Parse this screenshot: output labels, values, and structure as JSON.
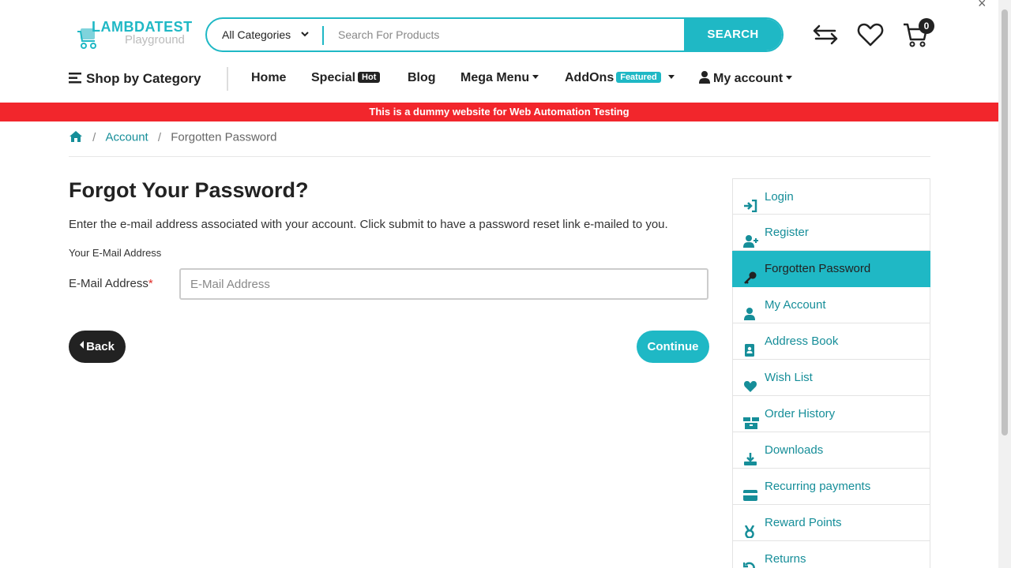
{
  "header": {
    "logo_brand": "LAMBDATEST",
    "logo_sub": "Playground",
    "category_select": "All Categories",
    "search_placeholder": "Search For Products",
    "search_button": "SEARCH",
    "cart_count": "0",
    "close_glyph": "×"
  },
  "nav": {
    "shop_by_category": "Shop by Category",
    "home": "Home",
    "special": "Special",
    "special_badge": "Hot",
    "blog": "Blog",
    "mega_menu": "Mega Menu",
    "addons": "AddOns",
    "addons_badge": "Featured",
    "my_account": "My account"
  },
  "banner": "This is a dummy website for Web Automation Testing",
  "breadcrumb": {
    "sep": "/",
    "account": "Account",
    "current": "Forgotten Password"
  },
  "main": {
    "title": "Forgot Your Password?",
    "intro": "Enter the e-mail address associated with your account. Click submit to have a password reset link e-mailed to you.",
    "legend": "Your E-Mail Address",
    "email_label": "E-Mail Address",
    "required_mark": "*",
    "email_placeholder": "E-Mail Address",
    "email_value": "",
    "back_button": "Back",
    "continue_button": "Continue"
  },
  "sidebar": {
    "items": [
      {
        "label": "Login",
        "icon": "sign-in-icon"
      },
      {
        "label": "Register",
        "icon": "user-plus-icon"
      },
      {
        "label": "Forgotten Password",
        "icon": "key-icon",
        "active": true
      },
      {
        "label": "My Account",
        "icon": "user-icon"
      },
      {
        "label": "Address Book",
        "icon": "address-book-icon"
      },
      {
        "label": "Wish List",
        "icon": "heart-icon"
      },
      {
        "label": "Order History",
        "icon": "boxes-icon"
      },
      {
        "label": "Downloads",
        "icon": "download-icon"
      },
      {
        "label": "Recurring payments",
        "icon": "credit-card-icon"
      },
      {
        "label": "Reward Points",
        "icon": "medal-icon"
      },
      {
        "label": "Returns",
        "icon": "undo-icon"
      }
    ]
  },
  "colors": {
    "accent": "#1fb8c5",
    "link": "#168e99",
    "banner": "#f2262c",
    "dark": "#222222"
  }
}
